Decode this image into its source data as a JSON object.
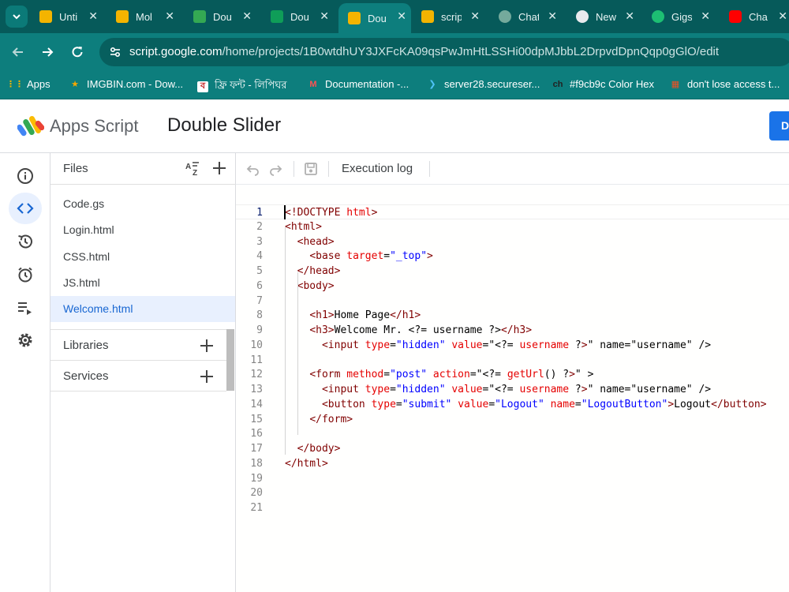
{
  "browser": {
    "tabs": [
      {
        "title": "Unti",
        "icon": "apps-script-favicon",
        "active": false
      },
      {
        "title": "Mol",
        "icon": "apps-script-favicon",
        "active": false
      },
      {
        "title": "Dou",
        "icon": "google-drive-favicon",
        "active": false
      },
      {
        "title": "Dou",
        "icon": "google-sheets-favicon",
        "active": false
      },
      {
        "title": "Dou",
        "icon": "apps-script-favicon",
        "active": true
      },
      {
        "title": "scrip",
        "icon": "apps-script-favicon",
        "active": false
      },
      {
        "title": "Chat",
        "icon": "chatgpt-favicon",
        "active": false
      },
      {
        "title": "New",
        "icon": "chrome-favicon",
        "active": false
      },
      {
        "title": "Gigs",
        "icon": "fiverr-favicon",
        "active": false
      },
      {
        "title": "Cha",
        "icon": "youtube-favicon",
        "active": false
      }
    ],
    "url_host": "script.google.com",
    "url_path": "/home/projects/1B0wtdhUY3JXFcKA09qsPwJmHtLSSHi00dpMJbbL2DrpvdDpnQqp0gGlO/edit",
    "bookmarks": [
      {
        "label": "Apps",
        "icon": "apps-grid-icon"
      },
      {
        "label": "IMGBIN.com - Dow...",
        "icon": "star-icon"
      },
      {
        "label": "ফ্রি ফন্ট - লিপিঘর",
        "icon": "lipighor-icon"
      },
      {
        "label": "Documentation -...",
        "icon": "documentation-icon"
      },
      {
        "label": "server28.secureser...",
        "icon": "server-arrow-icon"
      },
      {
        "label": "#f9cb9c Color Hex",
        "icon": "colorhex-icon"
      },
      {
        "label": "don't lose access t...",
        "icon": "microsoft-icon"
      }
    ]
  },
  "app": {
    "brand": "Apps Script",
    "project_name": "Double Slider",
    "deploy_label": "D"
  },
  "files_panel": {
    "title": "Files",
    "files": [
      "Code.gs",
      "Login.html",
      "CSS.html",
      "JS.html",
      "Welcome.html"
    ],
    "active_file": "Welcome.html",
    "sections": [
      "Libraries",
      "Services"
    ]
  },
  "editor": {
    "toolbar": {
      "execution_log": "Execution log"
    },
    "current_line": 1,
    "lines": [
      {
        "n": "1",
        "code": "<!DOCTYPE html>"
      },
      {
        "n": "2",
        "code": "<html>"
      },
      {
        "n": "3",
        "code": "  <head>"
      },
      {
        "n": "4",
        "code": "    <base target=\"_top\">"
      },
      {
        "n": "5",
        "code": "  </head>"
      },
      {
        "n": "6",
        "code": "  <body>"
      },
      {
        "n": "7",
        "code": ""
      },
      {
        "n": "8",
        "code": "    <h1>Home Page</h1>"
      },
      {
        "n": "9",
        "code": "    <h3>Welcome Mr. <?= username ?></h3>"
      },
      {
        "n": "10",
        "code": "      <input type=\"hidden\" value=\"<?= username ?>\" name=\"username\" />"
      },
      {
        "n": "11",
        "code": ""
      },
      {
        "n": "12",
        "code": "    <form method=\"post\" action=\"<?= getUrl() ?>\" >"
      },
      {
        "n": "13",
        "code": "      <input type=\"hidden\" value=\"<?= username ?>\" name=\"username\" />"
      },
      {
        "n": "14",
        "code": "      <button type=\"submit\" value=\"Logout\" name=\"LogoutButton\">Logout</button>"
      },
      {
        "n": "15",
        "code": "    </form>"
      },
      {
        "n": "16",
        "code": ""
      },
      {
        "n": "17",
        "code": "  </body>"
      },
      {
        "n": "18",
        "code": "</html>"
      },
      {
        "n": "19",
        "code": ""
      },
      {
        "n": "20",
        "code": ""
      },
      {
        "n": "21",
        "code": ""
      }
    ]
  },
  "colors": {
    "browser_frame": "#065a5a",
    "toolbar": "#0d7e7d",
    "accent_blue": "#1a73e8",
    "active_file_bg": "#e8f0fe"
  }
}
